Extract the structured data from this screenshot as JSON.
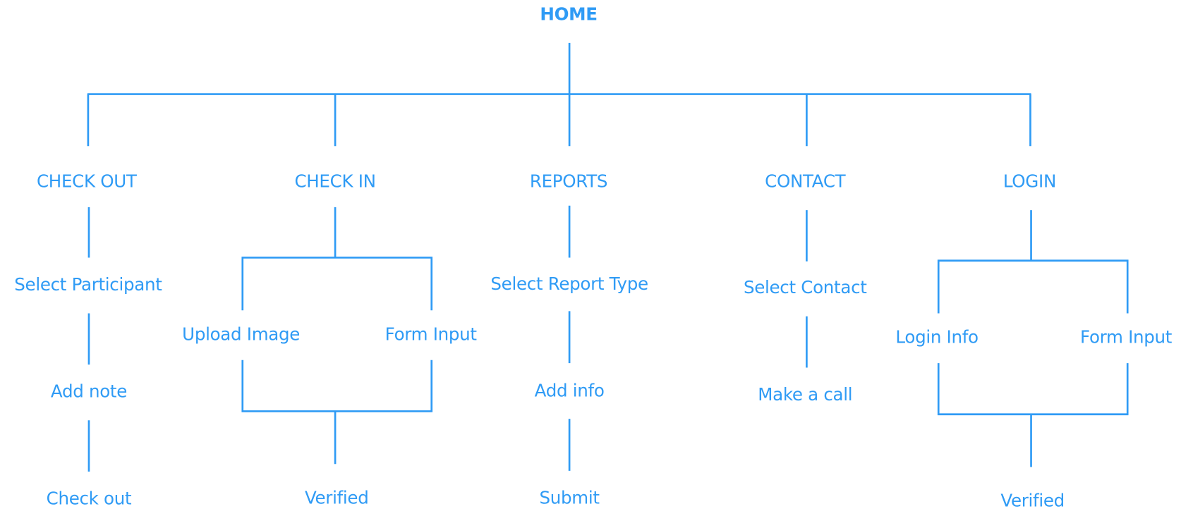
{
  "diagram": {
    "type": "site-map tree",
    "accent_color": "#2f9bf5",
    "root": "HOME",
    "sections": {
      "checkout": {
        "label": "CHECK OUT",
        "steps": [
          "Select Participant",
          "Add note",
          "Check out"
        ]
      },
      "checkin": {
        "label": "CHECK IN",
        "branches": [
          "Upload Image",
          "Form Input"
        ],
        "result": "Verified"
      },
      "reports": {
        "label": "REPORTS",
        "steps": [
          "Select Report Type",
          "Add info",
          "Submit"
        ]
      },
      "contact": {
        "label": "CONTACT",
        "steps": [
          "Select Contact",
          "Make a call"
        ]
      },
      "login": {
        "label": "LOGIN",
        "branches": [
          "Login Info",
          "Form Input"
        ],
        "result": "Verified"
      }
    }
  }
}
